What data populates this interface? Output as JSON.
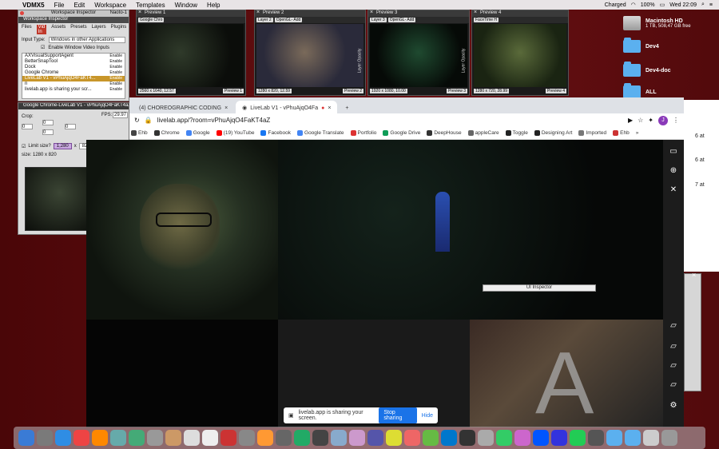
{
  "menubar": {
    "app": "VDMX5",
    "items": [
      "File",
      "Edit",
      "Workspace",
      "Templates",
      "Window",
      "Help"
    ],
    "battery": "100%",
    "clock": "Wed 22:09",
    "charge_label": "Charged"
  },
  "previews": [
    {
      "title": "Preview 1",
      "source": "Google Chro",
      "resolution": "2560 x 1640, 12.57",
      "label": "Preview 1"
    },
    {
      "title": "Preview 2",
      "source": "Layer 2",
      "extra": "OpenGL- Add",
      "resolution": "1280 x 820, 12.59",
      "label": "Preview 2",
      "side": "Layer Opacity"
    },
    {
      "title": "Preview 3",
      "source": "Layer 3",
      "extra": "OpenGL- Add",
      "resolution": "1920 x 1080, 10.00",
      "label": "Preview 3",
      "side": "Layer Opacity"
    },
    {
      "title": "Preview 4",
      "source": "FaceTime H",
      "resolution": "1280 x 720, 28.99",
      "label": "Preview 4"
    }
  ],
  "inspector": {
    "title": "Workspace Inspector",
    "name": "Naoto-1",
    "subtitle": "Workspace Inspector",
    "tabs": [
      "Files",
      "Vid In",
      "Assets",
      "Presets",
      "Layers",
      "Plugins"
    ],
    "active_tab": "Vid In",
    "input_type_label": "Input Type:",
    "input_type_value": "Windows in other Applications",
    "enable_window_inputs": "Enable Window Video Inputs",
    "list": [
      {
        "label": "AXVisualSupportAgent",
        "en": "Enable"
      },
      {
        "label": "BetterSnapTool",
        "en": "Enable"
      },
      {
        "label": "Dock",
        "en": "Enable"
      },
      {
        "label": "Google Chrome",
        "en": "Enable"
      },
      {
        "label": "LiveLab V1 - vPhuAjqO4FaKT4...",
        "en": "Enable"
      },
      {
        "label": "n",
        "en": "Enable"
      },
      {
        "label": "livelab.app is sharing your scr...",
        "en": "Enable"
      }
    ],
    "selected_index": 4
  },
  "inspector2": {
    "subtitle": "Google Chrome-LiveLab V1 - vPhuAjqO4FaKT4aZ",
    "crop_label": "Crop:",
    "fps_label": "FPS:",
    "fps_value": "29.97",
    "crop_values": [
      "0",
      "0",
      "0",
      "0"
    ],
    "limit_label": "Limit size?",
    "limit_w": "1,280",
    "limit_x": "x",
    "limit_h": "820",
    "size_label": "size: 1280 x 820"
  },
  "chrome": {
    "tabs": [
      {
        "label": "(4) CHOREOGRAPHIC CODING"
      },
      {
        "label": "LiveLab V1 - vPhuAjqO4Fa"
      }
    ],
    "new_tab": "+",
    "url": "livelab.app/?room=vPhuAjqO4FaKT4aZ",
    "avatar": "J",
    "bookmarks": [
      {
        "label": "Ehb",
        "color": "#444444"
      },
      {
        "label": "Chrome",
        "color": "#333333"
      },
      {
        "label": "Google",
        "color": "#4285f4"
      },
      {
        "label": "(19) YouTube",
        "color": "#ff0000"
      },
      {
        "label": "Facebook",
        "color": "#1877f2"
      },
      {
        "label": "Google Translate",
        "color": "#4285f4"
      },
      {
        "label": "Portfolio",
        "color": "#d33"
      },
      {
        "label": "Google Drive",
        "color": "#0f9d58"
      },
      {
        "label": "DeepHouse",
        "color": "#333333"
      },
      {
        "label": "appleCare",
        "color": "#666666"
      },
      {
        "label": "Toggle",
        "color": "#222222"
      },
      {
        "label": "Designing Art",
        "color": "#222222"
      },
      {
        "label": "Imported",
        "color": "#777777"
      },
      {
        "label": "Ehb",
        "color": "#c33"
      }
    ],
    "more": "»"
  },
  "page": {
    "ui_inspector": "UI Inspector",
    "share_text": "livelab.app is sharing your screen.",
    "stop_sharing": "Stop sharing",
    "hide": "Hide",
    "big_letter": "A"
  },
  "desktop": {
    "hd_name": "Macintosh HD",
    "hd_info": "1 TB, 508,47 GB free",
    "folders": [
      "Dev4",
      "Dev4-doc",
      "ALL"
    ],
    "side_texts": [
      "6 at",
      "6 at",
      "7 at"
    ]
  }
}
